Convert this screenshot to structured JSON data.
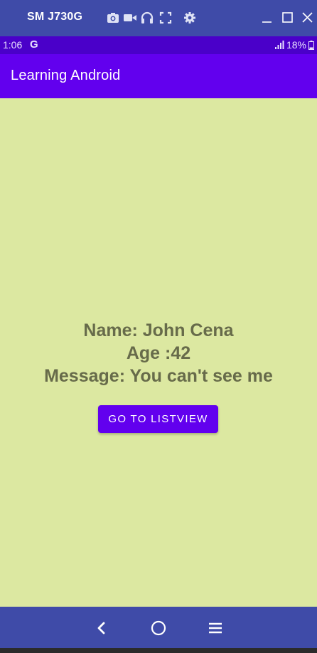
{
  "window": {
    "title": "SM J730G",
    "tools": [
      "camera-icon",
      "video-icon",
      "headphones-icon",
      "fullscreen-icon",
      "settings-icon"
    ],
    "controls": [
      "minimize-icon",
      "maximize-icon",
      "close-icon"
    ]
  },
  "status_bar": {
    "time": "1:06",
    "g_icon": "G",
    "battery": "18%"
  },
  "app_bar": {
    "title": "Learning Android"
  },
  "content": {
    "name_line": "Name: John Cena",
    "age_line": "Age :42",
    "message_line": "Message: You can't see me",
    "button_label": "GO TO LISTVIEW"
  },
  "navigation": {
    "buttons": [
      "back-icon",
      "home-icon",
      "recents-icon"
    ]
  },
  "colors": {
    "window_bar": "#3f4ba8",
    "status_bar": "#4a00c9",
    "primary": "#6200ee",
    "background": "#dce8a1",
    "text": "#676b4a"
  }
}
